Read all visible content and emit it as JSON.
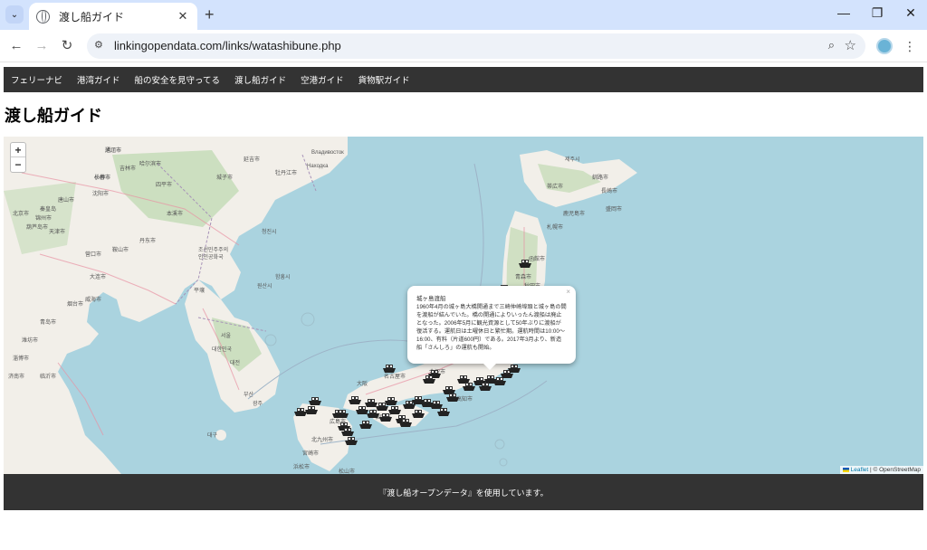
{
  "browser": {
    "tab_title": "渡し船ガイド",
    "url": "linkingopendata.com/links/watashibune.php"
  },
  "nav": {
    "items": [
      "フェリーナビ",
      "港湾ガイド",
      "船の安全を見守ってる",
      "渡し船ガイド",
      "空港ガイド",
      "貨物駅ガイド"
    ]
  },
  "page": {
    "heading": "渡し船ガイド"
  },
  "map": {
    "zoom_in": "+",
    "zoom_out": "−",
    "attribution_leaflet": "Leaflet",
    "attribution_osm": "| © OpenStreetMap",
    "labels": [
      "通辽市",
      "长春市",
      "吉林市",
      "哈尔滨市",
      "沈阳市",
      "四平市",
      "丹东市",
      "大连市",
      "营口市",
      "鞍山市",
      "本溪市",
      "延吉市",
      "牡丹江市",
      "城子市",
      "Владивосток",
      "Находка",
      "唐山市",
      "秦皇岛",
      "锦州市",
      "葫芦岛市",
      "北京市",
      "天津市",
      "青岛市",
      "烟台市",
      "威海市",
      "潍坊市",
      "淄博市",
      "济南市",
      "临沂市",
      "平壤",
      "조선민주주의",
      "인민공화국",
      "원산시",
      "함흥시",
      "청진시",
      "서울",
      "대한민국",
      "대전",
      "광주",
      "부산",
      "대구",
      "제주시",
      "札幌市",
      "函館市",
      "青森市",
      "秋田市",
      "仙台市",
      "新潟市",
      "金沢市",
      "名古屋市",
      "大阪",
      "広島市",
      "北九州市",
      "福岡市",
      "高知市",
      "松山市",
      "浜松市",
      "宮崎市",
      "鹿児島市",
      "長崎市",
      "盛岡市",
      "釧路市",
      "帯広市",
      "旭川市",
      "小樽市"
    ],
    "marker_count": 40,
    "popup": {
      "title": "城ヶ島渡船",
      "body": "1960年4月の城ヶ島大橋開通まで三崎仲崎埠頭と城ヶ島の間を渡船が結んでいた。橋の開通によりいったん渡船は廃止となった。2006年5月に観光資源として50年ぶりに渡船が復活する。運航日は土曜休日と繁忙期。運航時間は10:00～16:00、有料（片道600円）である。2017年3月より、新造船「さんしろ」の運航も開始。",
      "close": "×"
    }
  },
  "footer": {
    "text": "『渡し船オープンデータ』を使用しています。"
  },
  "colors": {
    "sea": "#aad3df",
    "land": "#f2efe9",
    "forest": "#add19e",
    "nav_bg": "#333333",
    "chrome": "#d3e3fd"
  }
}
